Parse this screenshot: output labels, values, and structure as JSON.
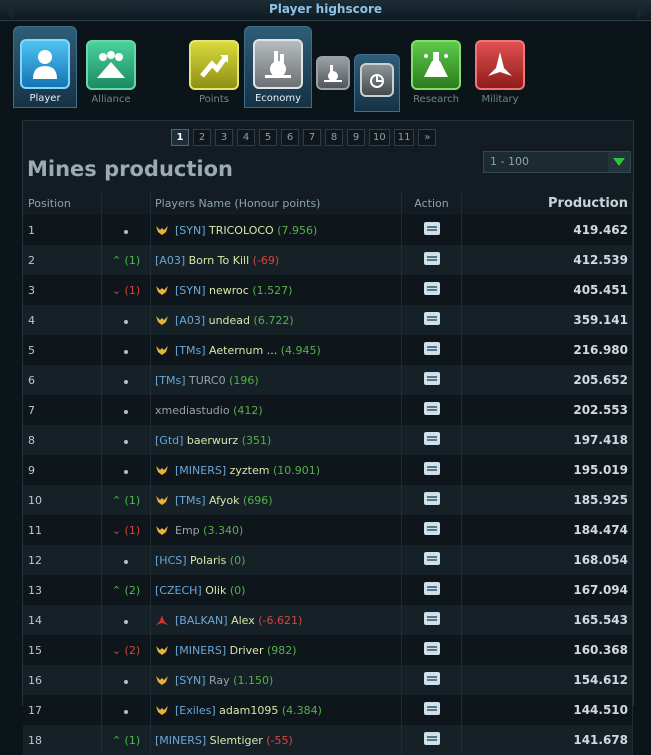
{
  "window": {
    "title": "Player highscore"
  },
  "tabs": [
    {
      "label": "Player",
      "icon": "player-icon",
      "active": true
    },
    {
      "label": "Alliance",
      "icon": "alliance-icon",
      "active": false
    },
    {
      "label": "Points",
      "icon": "points-icon",
      "active": false
    },
    {
      "label": "Economy",
      "icon": "economy-icon",
      "active": true
    },
    {
      "label": "",
      "icon": "economy-sub-icon",
      "active": false
    },
    {
      "label": "",
      "icon": "economy-sub-active-icon",
      "active": true
    },
    {
      "label": "Research",
      "icon": "research-icon",
      "active": false
    },
    {
      "label": "Military",
      "icon": "military-icon",
      "active": false
    }
  ],
  "pager": {
    "pages": [
      "1",
      "2",
      "3",
      "4",
      "5",
      "6",
      "7",
      "8",
      "9",
      "10",
      "11",
      "»"
    ],
    "current": "1"
  },
  "heading": "Mines production",
  "range_select": {
    "value": "1 - 100"
  },
  "table": {
    "headers": {
      "position": "Position",
      "name": "Players Name (Honour points)",
      "action": "Action",
      "production": "Production"
    },
    "rows": [
      {
        "pos": "1",
        "move": "",
        "dir": "none",
        "wing": true,
        "tag": "[SYN]",
        "name": "TRICOLOCO",
        "honour": "(7.956)",
        "hc": "pos",
        "prod": "419.462"
      },
      {
        "pos": "2",
        "move": "^ (1)",
        "dir": "up",
        "wing": false,
        "tag": "[A03]",
        "name": "Born To Kill",
        "honour": "(-69)",
        "hc": "neg",
        "prod": "412.539"
      },
      {
        "pos": "3",
        "move": "v (1)",
        "dir": "down",
        "wing": true,
        "tag": "[SYN]",
        "name": "newroc",
        "honour": "(1.527)",
        "hc": "pos",
        "prod": "405.451"
      },
      {
        "pos": "4",
        "move": "",
        "dir": "none",
        "wing": true,
        "tag": "[A03]",
        "name": "undead",
        "honour": "(6.722)",
        "hc": "pos",
        "prod": "359.141"
      },
      {
        "pos": "5",
        "move": "",
        "dir": "none",
        "wing": true,
        "tag": "[TMs]",
        "name": "Aeternum ...",
        "honour": "(4.945)",
        "hc": "pos",
        "prod": "216.980"
      },
      {
        "pos": "6",
        "move": "",
        "dir": "none",
        "wing": false,
        "tag": "[TMs]",
        "name": "TURC0",
        "honour": "(196)",
        "hc": "pos",
        "grey": true,
        "prod": "205.652"
      },
      {
        "pos": "7",
        "move": "",
        "dir": "none",
        "wing": false,
        "tag": "",
        "name": "xmediastudio",
        "honour": "(412)",
        "hc": "pos",
        "grey": true,
        "prod": "202.553"
      },
      {
        "pos": "8",
        "move": "",
        "dir": "none",
        "wing": false,
        "tag": "[Gtd]",
        "name": "baerwurz",
        "honour": "(351)",
        "hc": "pos",
        "prod": "197.418"
      },
      {
        "pos": "9",
        "move": "",
        "dir": "none",
        "wing": true,
        "tag": "[MINERS]",
        "name": "zyztem",
        "honour": "(10.901)",
        "hc": "pos",
        "prod": "195.019"
      },
      {
        "pos": "10",
        "move": "^ (1)",
        "dir": "up",
        "wing": true,
        "tag": "[TMs]",
        "name": "Afyok",
        "honour": "(696)",
        "hc": "pos",
        "prod": "185.925"
      },
      {
        "pos": "11",
        "move": "v (1)",
        "dir": "down",
        "wing": true,
        "tag": "",
        "name": "Emp",
        "honour": "(3.340)",
        "hc": "pos",
        "grey": true,
        "prod": "184.474"
      },
      {
        "pos": "12",
        "move": "",
        "dir": "none",
        "wing": false,
        "tag": "[HCS]",
        "name": "PoIaris",
        "honour": "(0)",
        "hc": "pos",
        "prod": "168.054"
      },
      {
        "pos": "13",
        "move": "^ (2)",
        "dir": "up",
        "wing": false,
        "tag": "[CZECH]",
        "name": "Olik",
        "honour": "(0)",
        "hc": "pos",
        "prod": "167.094"
      },
      {
        "pos": "14",
        "move": "",
        "dir": "none",
        "wing": false,
        "redicon": true,
        "tag": "[BALKAN]",
        "name": "Alex",
        "honour": "(-6.621)",
        "hc": "neg",
        "prod": "165.543"
      },
      {
        "pos": "15",
        "move": "v (2)",
        "dir": "down",
        "wing": true,
        "tag": "[MINERS]",
        "name": "Driver",
        "honour": "(982)",
        "hc": "pos",
        "prod": "160.368"
      },
      {
        "pos": "16",
        "move": "",
        "dir": "none",
        "wing": true,
        "tag": "[SYN]",
        "name": "Ray",
        "honour": "(1.150)",
        "hc": "pos",
        "grey": true,
        "prod": "154.612"
      },
      {
        "pos": "17",
        "move": "",
        "dir": "none",
        "wing": true,
        "tag": "[Exiles]",
        "name": "adam1095",
        "honour": "(4.384)",
        "hc": "pos",
        "prod": "144.510"
      },
      {
        "pos": "18",
        "move": "^ (1)",
        "dir": "up",
        "wing": false,
        "tag": "[MINERS]",
        "name": "Slemtiger",
        "honour": "(-55)",
        "hc": "neg",
        "prod": "141.678"
      }
    ]
  },
  "colors": {
    "accent": "#8dc3e8",
    "up": "#52b94a",
    "down": "#d3463c",
    "tag": "#6aa8d8"
  }
}
